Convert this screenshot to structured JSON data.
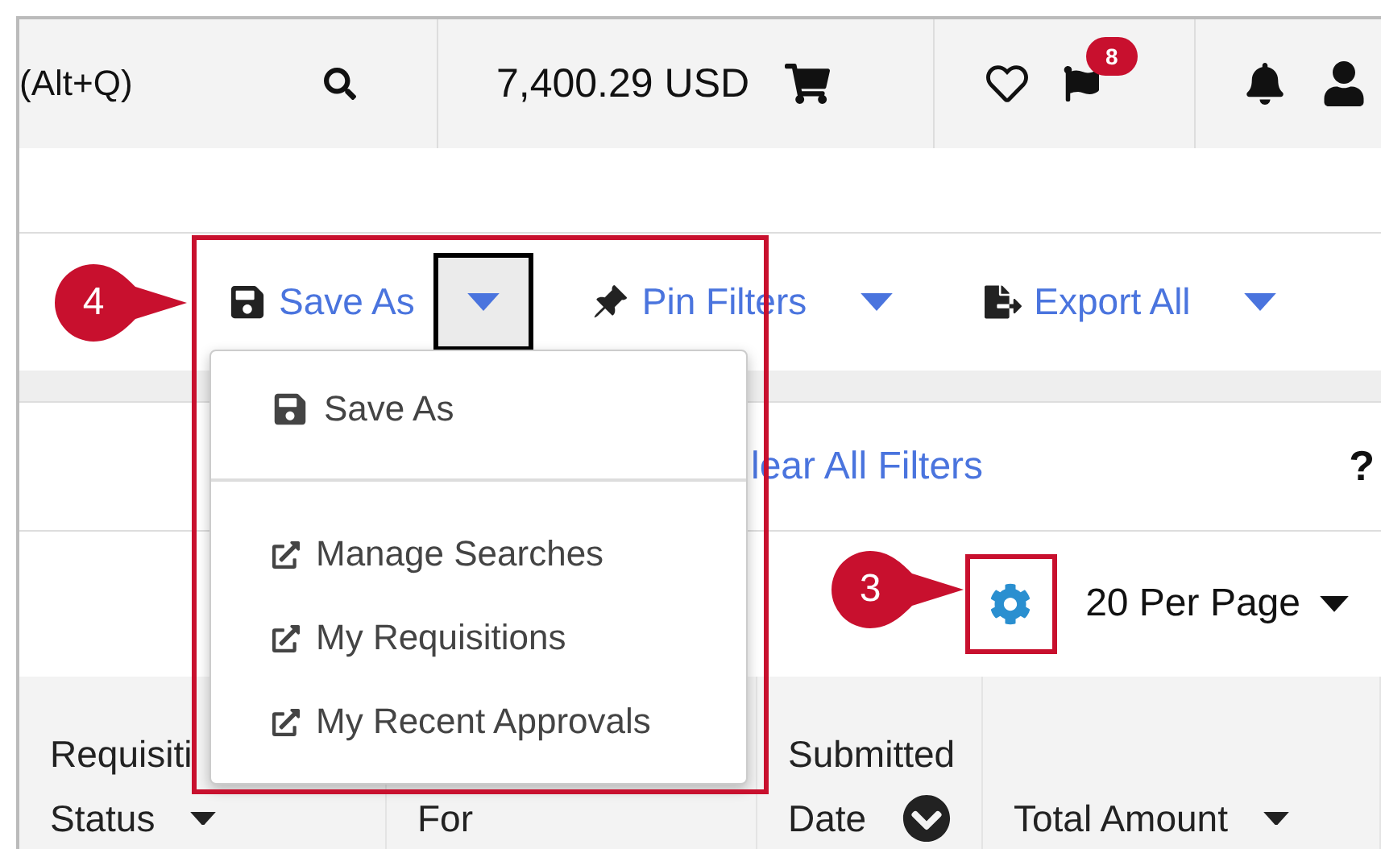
{
  "header": {
    "search_hint": "(Alt+Q)",
    "cart_total": "7,400.29 USD",
    "flag_count": "8"
  },
  "toolbar": [
    {
      "label": "Save As",
      "kind": "save",
      "caret_focused": true
    },
    {
      "label": "Pin Filters",
      "kind": "pin",
      "caret_focused": false
    },
    {
      "label": "Export All",
      "kind": "export",
      "caret_focused": false
    }
  ],
  "dropdown": [
    {
      "label": "Save As",
      "kind": "save"
    },
    {
      "label": "Manage Searches",
      "kind": "link"
    },
    {
      "label": "My Requisitions",
      "kind": "link"
    },
    {
      "label": "My Recent Approvals",
      "kind": "link"
    }
  ],
  "filters": {
    "clear_link": "lear All Filters",
    "help": "?"
  },
  "paging": {
    "per_page": "20 Per Page"
  },
  "columns": [
    {
      "lines": [
        "Requisiti",
        "Status"
      ],
      "kind": "caret"
    },
    {
      "lines": [
        "For"
      ],
      "kind": "plain"
    },
    {
      "lines": [
        "Submitted",
        "Date"
      ],
      "kind": "circle"
    },
    {
      "lines": [
        "Total Amount"
      ],
      "kind": "caret"
    }
  ],
  "callouts": [
    {
      "number": "4"
    },
    {
      "number": "3"
    }
  ]
}
